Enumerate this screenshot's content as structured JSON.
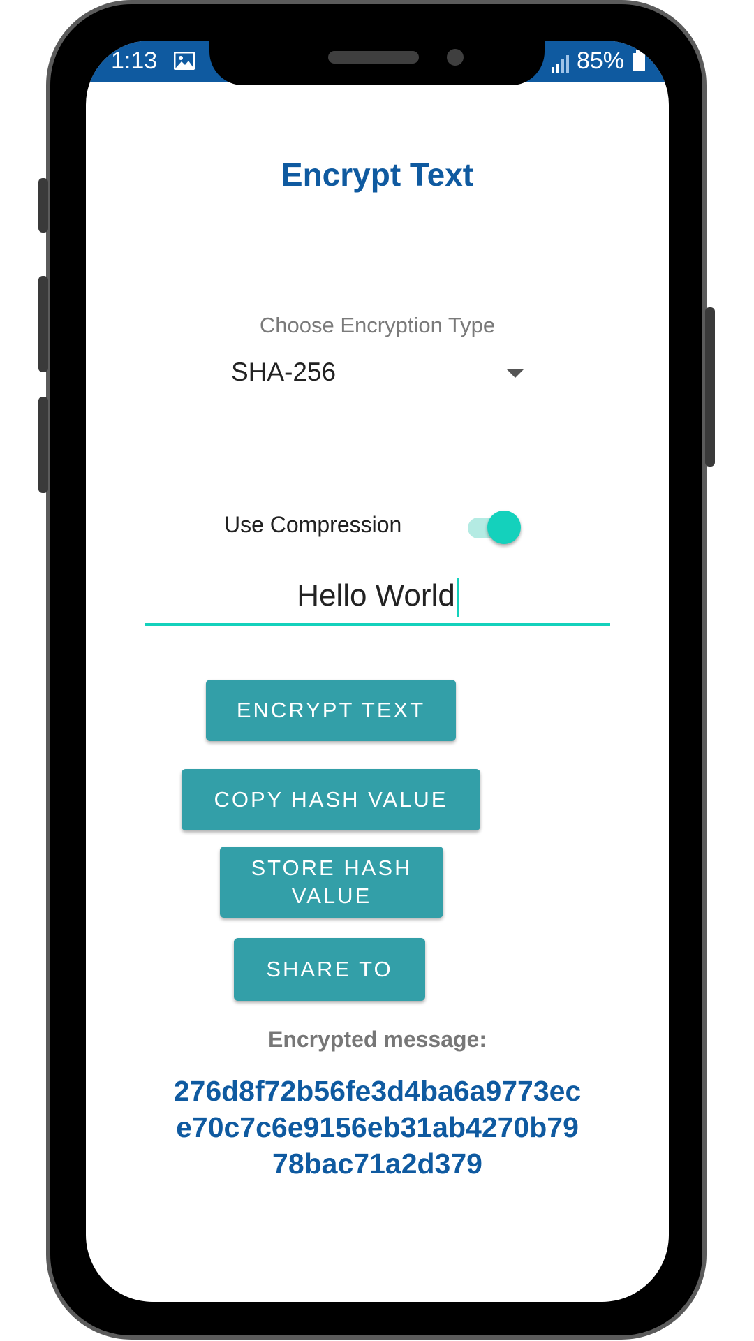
{
  "status_bar": {
    "time": "1:13",
    "battery_percent": "85%",
    "icons": [
      "image-icon",
      "signal-icon",
      "battery-icon"
    ]
  },
  "page": {
    "title": "Encrypt Text"
  },
  "encryption": {
    "label": "Choose Encryption Type",
    "selected": "SHA-256"
  },
  "compression": {
    "label": "Use Compression",
    "enabled": true
  },
  "input": {
    "value": "Hello World"
  },
  "buttons": {
    "encrypt": "ENCRYPT TEXT",
    "copy": "COPY HASH VALUE",
    "store_line1": "STORE HASH",
    "store_line2": "VALUE",
    "share": "SHARE TO"
  },
  "result": {
    "label": "Encrypted message:",
    "line1": "276d8f72b56fe3d4ba6a9773ec",
    "line2": "e70c7c6e9156eb31ab4270b79",
    "line3": "78bac71a2d379"
  },
  "colors": {
    "primary": "#0f5aa0",
    "button": "#339fa8",
    "accent": "#14d1bc"
  }
}
